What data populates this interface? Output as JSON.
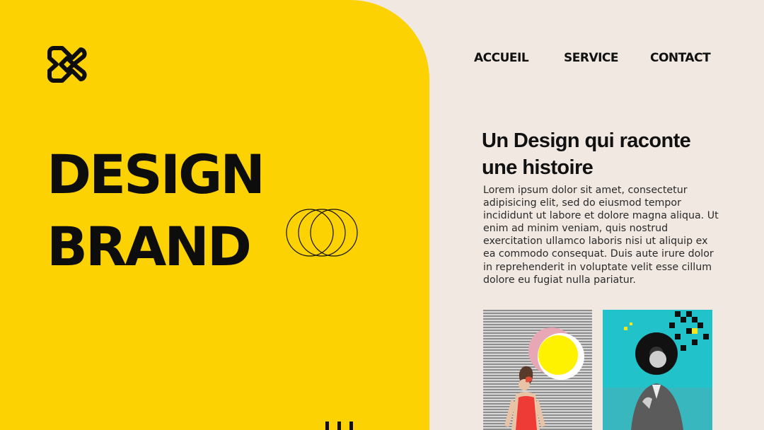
{
  "brand": {
    "logo_icon": "knot-logo-icon"
  },
  "nav": {
    "items": [
      {
        "label": "ACCUEIL"
      },
      {
        "label": "SERVICE"
      },
      {
        "label": "CONTACT"
      }
    ]
  },
  "hero": {
    "line1": "DESIGN",
    "line2": "BRAND",
    "decor_icon": "overlapping-circles-icon"
  },
  "content": {
    "title": "Un Design qui raconte une histoire",
    "body": "Lorem ipsum dolor sit amet, consectetur adipisicing elit, sed do eiusmod tempor incididunt ut labore et dolore magna aliqua. Ut enim ad minim veniam, quis nostrud exercitation ullamco laboris nisi ut aliquip ex ea commodo consequat. Duis aute irure dolor in reprehenderit in voluptate velit esse cillum dolore eu fugiat nulla pariatur."
  },
  "gallery": [
    {
      "name": "collage-woman-swimsuit-image"
    },
    {
      "name": "collage-man-vinyl-head-image"
    }
  ],
  "colors": {
    "accent_yellow": "#FDD203",
    "background": "#F0E8E1",
    "text": "#111111",
    "teal": "#22C2CB"
  }
}
